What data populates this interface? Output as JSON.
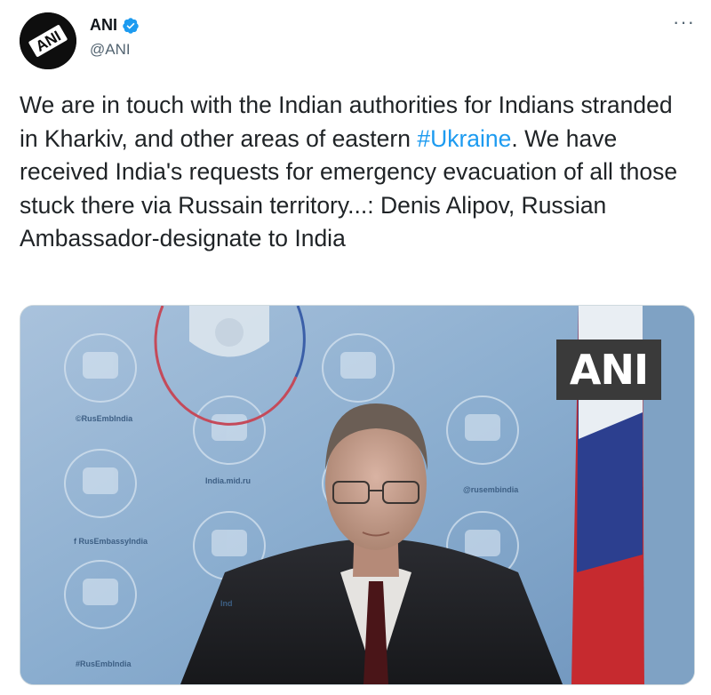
{
  "author": {
    "display_name": "ANI",
    "handle": "@ANI",
    "avatar_text": "ANI",
    "verified": true
  },
  "menu": {
    "more_label": "···"
  },
  "tweet": {
    "text_before": "We are in touch with the Indian authorities for Indians stranded in Kharkiv, and other areas of eastern ",
    "hashtag": "#Ukraine",
    "text_after": ". We have received India's requests for emergency evacuation of all those stuck there via Russain territory...: Denis Alipov, Russian Ambassador-designate to India"
  },
  "media": {
    "watermark": "ANI",
    "backdrop_texts": [
      "©RusEmbIndia",
      "India.mid.ru",
      "f RusEmbassyIndia",
      "@rusembindia",
      "#RusEmbIndia",
      "Ind"
    ]
  },
  "colors": {
    "hashtag": "#1d9bf0",
    "verified_badge": "#1d9bf0",
    "secondary_text": "#536471"
  }
}
